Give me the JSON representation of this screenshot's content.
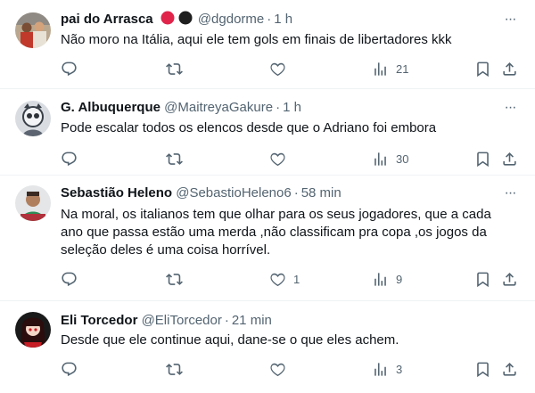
{
  "tweets": [
    {
      "name": "pai do Arrasca",
      "handle": "@dgdorme",
      "sep": "·",
      "time": "1 h",
      "text": "Não moro na Itália, aqui ele tem gols em finais de libertadores kkk",
      "like_count": "",
      "views": "21",
      "more": "···",
      "emoji_badges": [
        "red-circle",
        "black-circle"
      ]
    },
    {
      "name": "G. Albuquerque",
      "handle": "@MaitreyaGakure",
      "sep": "·",
      "time": "1 h",
      "text": "Pode escalar todos os elencos desde que o Adriano foi embora",
      "like_count": "",
      "views": "30",
      "more": "···"
    },
    {
      "name": "Sebastião Heleno",
      "handle": "@SebastioHeleno6",
      "sep": "·",
      "time": "58 min",
      "text": "Na moral, os italianos tem que  olhar para os seus jogadores, que a cada ano que passa estão uma merda ,não classificam pra copa ,os jogos da seleção deles é uma coisa horrível.",
      "like_count": "1",
      "views": "9",
      "more": "···"
    },
    {
      "name": "Eli Torcedor",
      "handle": "@EliTorcedor",
      "sep": "·",
      "time": "21 min",
      "text": "Desde que ele continue aqui, dane-se o que eles achem.",
      "like_count": "",
      "views": "3",
      "more": "···"
    }
  ],
  "colors": {
    "text_primary": "#0f1419",
    "text_secondary": "#536471",
    "divider": "#eff3f4",
    "background": "#ffffff"
  },
  "icons": {
    "reply": "speech-bubble-icon",
    "retweet": "retweet-icon",
    "like": "heart-icon",
    "views": "bar-chart-icon",
    "bookmark": "bookmark-icon",
    "share": "share-icon",
    "more": "more-dots-icon"
  }
}
